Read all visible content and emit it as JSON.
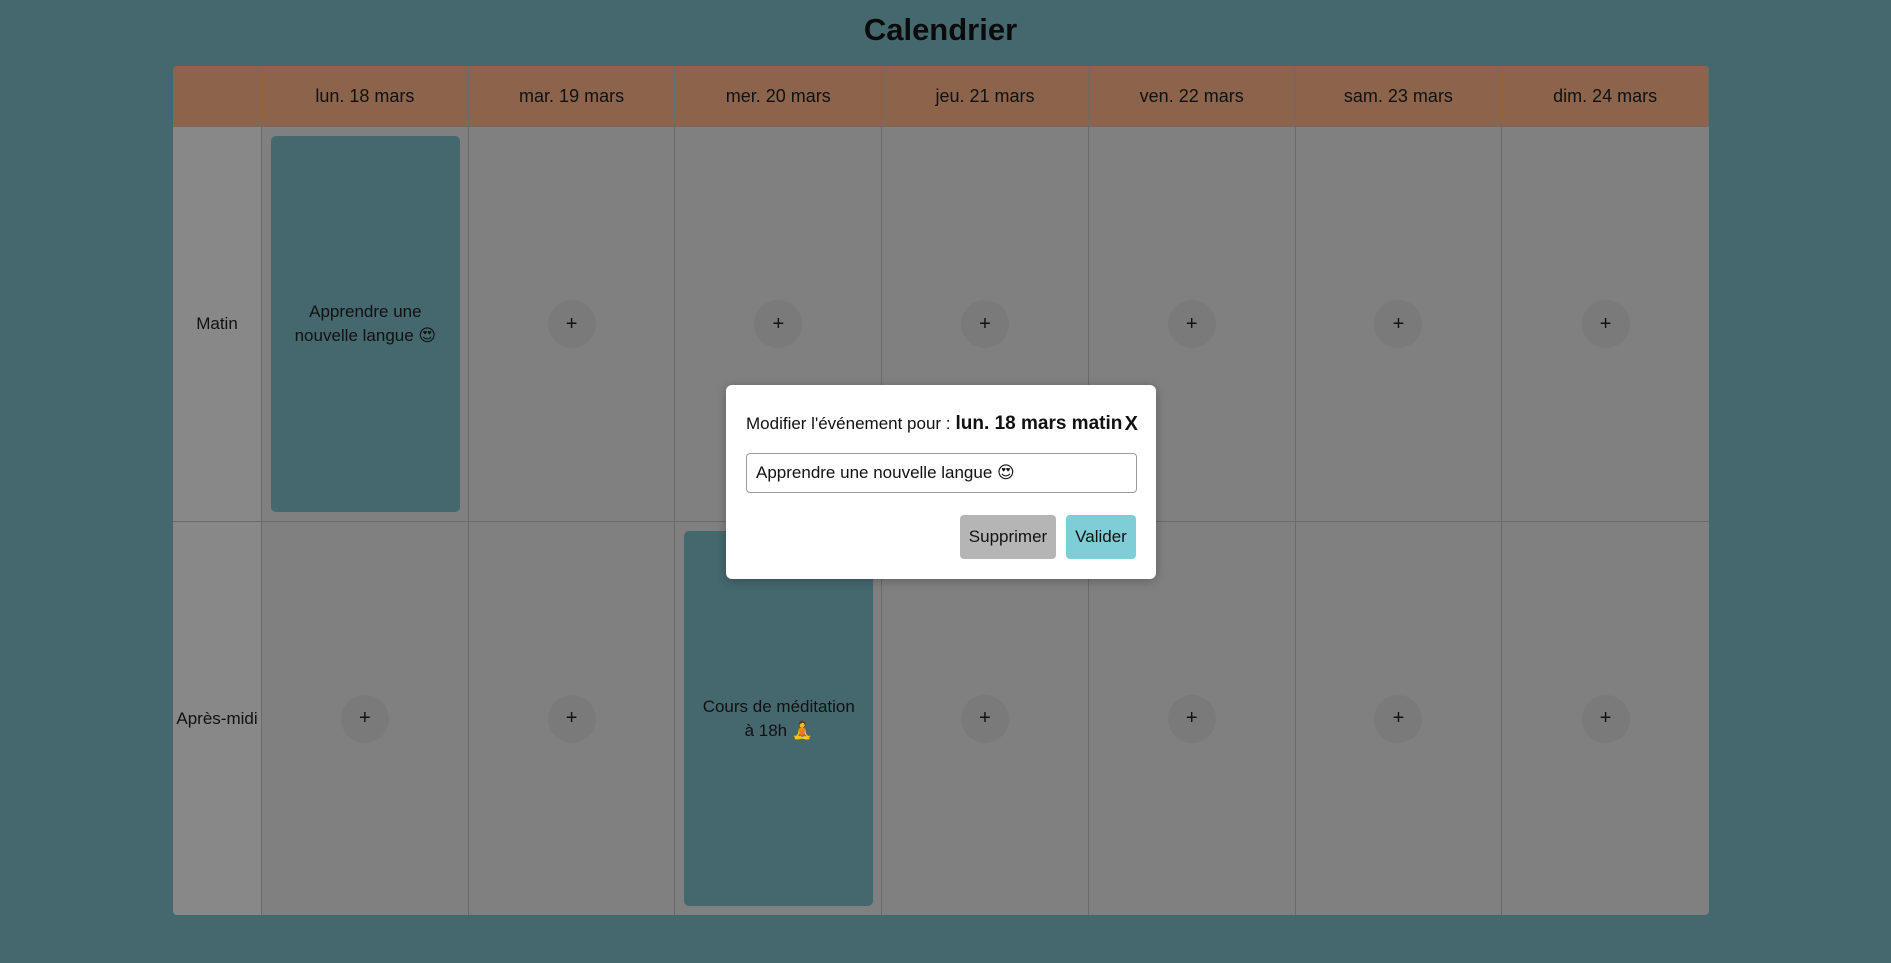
{
  "title": "Calendrier",
  "days": [
    "lun. 18 mars",
    "mar. 19 mars",
    "mer. 20 mars",
    "jeu. 21 mars",
    "ven. 22 mars",
    "sam. 23 mars",
    "dim. 24 mars"
  ],
  "periods": [
    "Matin",
    "Après-midi"
  ],
  "add_label": "+",
  "events": {
    "mon_morning": "Apprendre une nouvelle langue 😍",
    "wed_afternoon": "Cours de méditation à 18h 🧘"
  },
  "modal": {
    "prefix": "Modifier l'événement pour :",
    "target": "lun. 18 mars matin",
    "close": "X",
    "input_value": "Apprendre une nouvelle langue 😍",
    "delete_label": "Supprimer",
    "validate_label": "Valider"
  },
  "colors": {
    "background": "#44686e",
    "header": "#8c634b",
    "grid": "#808080",
    "event": "#44686e",
    "validate": "#7fcdd6",
    "delete": "#b5b5b5"
  }
}
